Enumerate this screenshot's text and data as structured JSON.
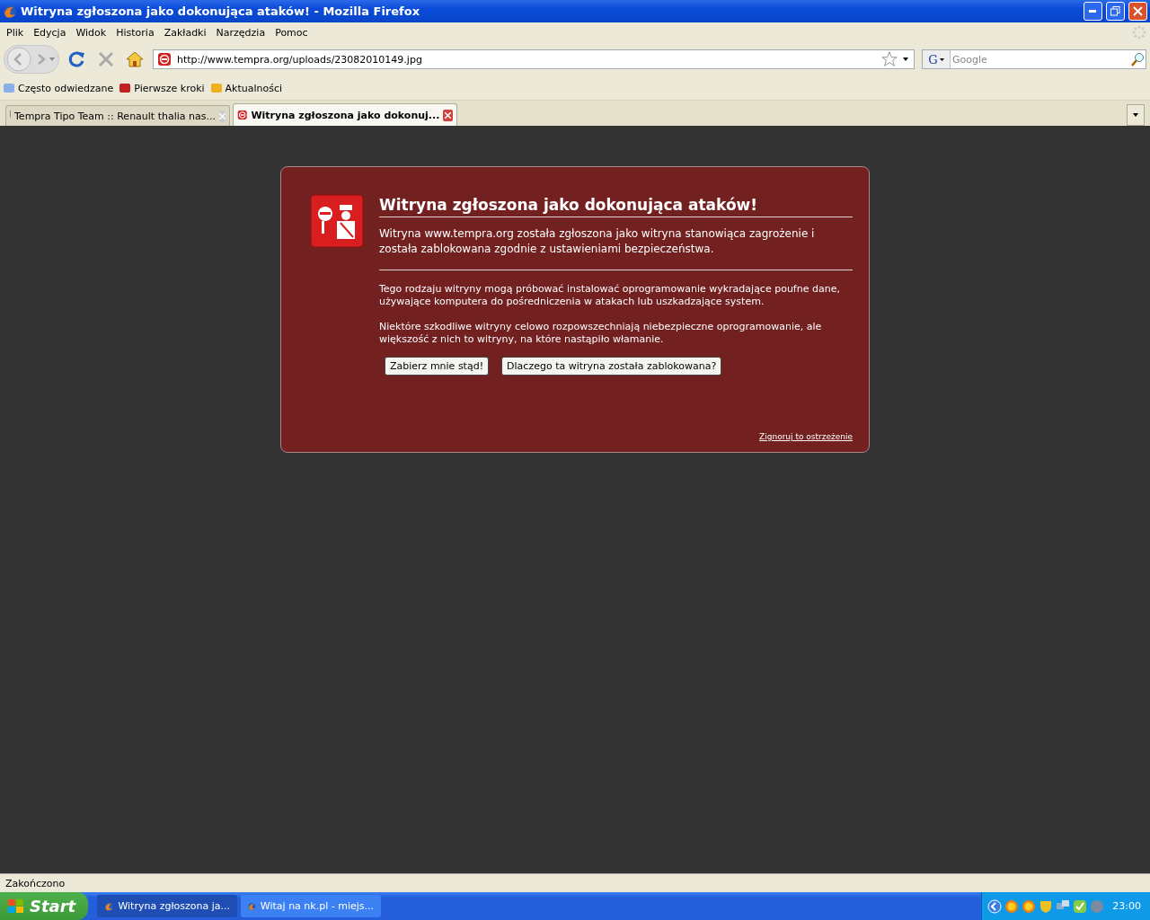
{
  "window": {
    "title": "Witryna zgłoszona jako dokonująca ataków! - Mozilla Firefox"
  },
  "menu": [
    "Plik",
    "Edycja",
    "Widok",
    "Historia",
    "Zakładki",
    "Narzędzia",
    "Pomoc"
  ],
  "navigation": {
    "url": "http://www.tempra.org/uploads/23082010149.jpg",
    "search": {
      "engine": "G",
      "placeholder": "Google"
    }
  },
  "bookmarks": [
    "Często odwiedzane",
    "Pierwsze kroki",
    "Aktualności"
  ],
  "tabs": [
    {
      "label": "Tempra Tipo Team :: Renault thalia nas...",
      "selected": false
    },
    {
      "label": "Witryna zgłoszona jako dokonuj...",
      "selected": true
    }
  ],
  "warning": {
    "title": "Witryna zgłoszona jako dokonująca ataków!",
    "intro": "Witryna www.tempra.org została zgłoszona jako witryna stanowiąca zagrożenie i została zablokowana zgodnie z ustawieniami bezpieczeństwa.",
    "paragraphs": [
      "Tego rodzaju witryny mogą próbować instalować oprogramowanie wykradające poufne dane, używające komputera do pośredniczenia w atakach lub uszkadzające system.",
      "Niektóre szkodliwe witryny celowo rozpowszechniają niebezpieczne oprogramowanie, ale większość z nich to witryny, na które nastąpiło włamanie."
    ],
    "buttons": [
      "Zabierz mnie stąd!",
      "Dlaczego ta witryna została zablokowana?"
    ],
    "ignore_link": "Zignoruj to ostrzeżenie"
  },
  "status_bar": "Zakończono",
  "taskbar": {
    "start": "Start",
    "tasks": [
      {
        "label": "Witryna zgłoszona ja...",
        "selected": true
      },
      {
        "label": "Witaj na nk.pl - miejs...",
        "selected": false
      }
    ],
    "clock": "23:00"
  }
}
